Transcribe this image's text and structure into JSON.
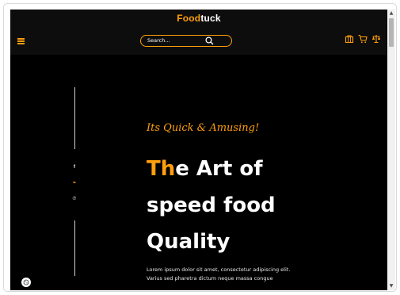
{
  "header": {
    "logo_accent": "Food",
    "logo_rest": "tuck",
    "search_placeholder": "Search..."
  },
  "icons": {
    "menu": "hamburger-icon",
    "search": "search-icon",
    "bag": "bag-icon",
    "cart": "cart-icon",
    "other": "scale-icon",
    "facebook": "facebook-icon",
    "twitter": "twitter-icon",
    "pinterest": "pinterest-icon",
    "cookie": "cookie-icon"
  },
  "social": {
    "facebook": "f",
    "twitter": "❧",
    "pinterest": "℗"
  },
  "hero": {
    "tagline": "Its Quick & Amusing!",
    "title_highlight": "Th",
    "title_line1_rest": "e Art of",
    "title_line2": "speed food",
    "title_line3": "Quality",
    "description_line1": "Lorem ipsum dolor sit amet, consectetur adipiscing elit.",
    "description_line2": "Varius sed pharetra dictum neque massa congue"
  },
  "colors": {
    "accent": "#ff9f0d",
    "background": "#000000",
    "text": "#ffffff"
  }
}
